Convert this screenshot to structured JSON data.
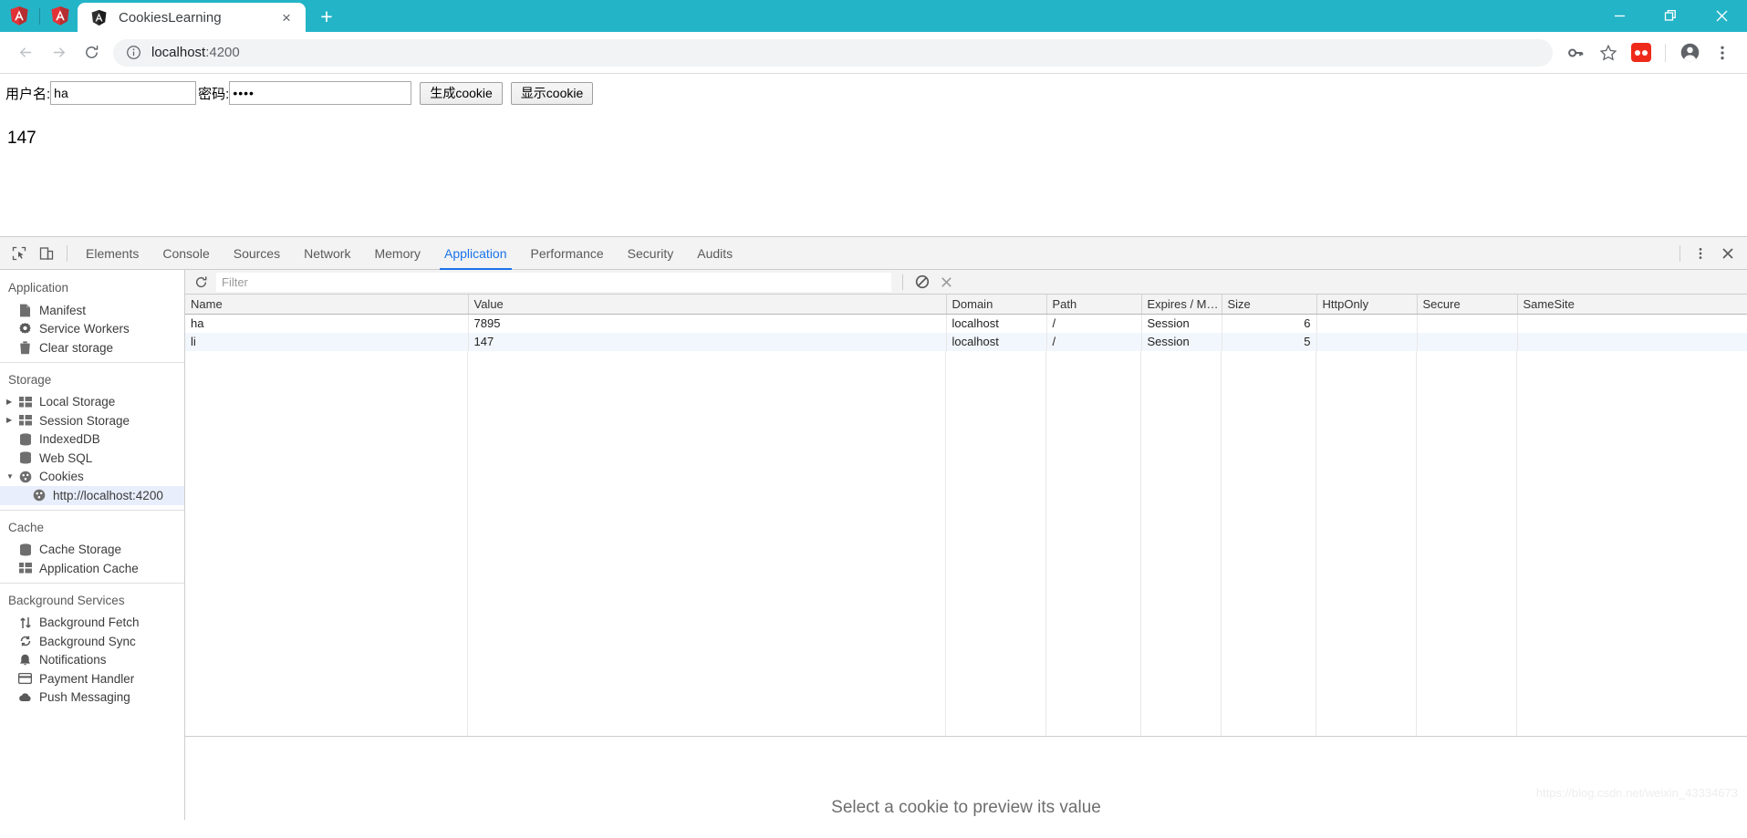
{
  "browser": {
    "pinned_tabs": [
      {
        "name": "angular-pinned-tab-1",
        "title": "Angular"
      },
      {
        "name": "angular-pinned-tab-2",
        "title": "Angular"
      }
    ],
    "active_tab": {
      "title": "CookiesLearning",
      "favicon": "angular-icon",
      "close_label": "×"
    },
    "new_tab_label": "+",
    "window_controls": {
      "minimize": "—",
      "restore": "restore-icon",
      "close": "×"
    },
    "nav": {
      "back": "back-arrow-icon",
      "forward": "forward-arrow-icon",
      "reload": "reload-icon"
    },
    "omnibox": {
      "info_icon": "info-circle-icon",
      "host": "localhost",
      "port": ":4200",
      "full_url": "localhost:4200"
    },
    "toolbar_icons": [
      {
        "name": "password-key-icon",
        "label": "Passwords"
      },
      {
        "name": "bookmark-star-icon",
        "label": "Bookmark"
      },
      {
        "name": "extension-icon",
        "label": "Extension"
      },
      {
        "name": "profile-avatar-icon",
        "label": "Profile"
      },
      {
        "name": "chrome-menu-icon",
        "label": "Customize and control"
      }
    ],
    "accent_color": "#24b4c7"
  },
  "page": {
    "username_label": "用户名:",
    "username_value": "ha",
    "username_placeholder": "",
    "password_label": "密码:",
    "password_value": "••••",
    "password_placeholder": "",
    "generate_button": "生成cookie",
    "show_button": "显示cookie",
    "result": "147"
  },
  "devtools": {
    "inspect_icon": "inspect-element-icon",
    "device_icon": "device-toolbar-icon",
    "tabs": [
      {
        "label": "Elements",
        "active": false
      },
      {
        "label": "Console",
        "active": false
      },
      {
        "label": "Sources",
        "active": false
      },
      {
        "label": "Network",
        "active": false
      },
      {
        "label": "Memory",
        "active": false
      },
      {
        "label": "Application",
        "active": true
      },
      {
        "label": "Performance",
        "active": false
      },
      {
        "label": "Security",
        "active": false
      },
      {
        "label": "Audits",
        "active": false
      }
    ],
    "active_tab_color": "#1a73e8",
    "more_icon": "devtools-more-options-icon",
    "close_icon": "devtools-close-icon",
    "sidebar": {
      "sections": [
        {
          "title": "Application",
          "items": [
            {
              "label": "Manifest",
              "icon": "document-icon",
              "arrow": "none",
              "selected": false,
              "nested": false
            },
            {
              "label": "Service Workers",
              "icon": "gear-icon",
              "arrow": "none",
              "selected": false,
              "nested": false
            },
            {
              "label": "Clear storage",
              "icon": "trash-icon",
              "arrow": "none",
              "selected": false,
              "nested": false
            }
          ]
        },
        {
          "title": "Storage",
          "items": [
            {
              "label": "Local Storage",
              "icon": "table-grid-icon",
              "arrow": "collapsed",
              "selected": false,
              "nested": false
            },
            {
              "label": "Session Storage",
              "icon": "table-grid-icon",
              "arrow": "collapsed",
              "selected": false,
              "nested": false
            },
            {
              "label": "IndexedDB",
              "icon": "database-icon",
              "arrow": "none",
              "selected": false,
              "nested": false
            },
            {
              "label": "Web SQL",
              "icon": "database-icon",
              "arrow": "none",
              "selected": false,
              "nested": false
            },
            {
              "label": "Cookies",
              "icon": "cookie-icon",
              "arrow": "expanded",
              "selected": false,
              "nested": false
            },
            {
              "label": "http://localhost:4200",
              "icon": "cookie-icon",
              "arrow": "none",
              "selected": true,
              "nested": true
            }
          ]
        },
        {
          "title": "Cache",
          "items": [
            {
              "label": "Cache Storage",
              "icon": "database-icon",
              "arrow": "none",
              "selected": false,
              "nested": false
            },
            {
              "label": "Application Cache",
              "icon": "table-grid-icon",
              "arrow": "none",
              "selected": false,
              "nested": false
            }
          ]
        },
        {
          "title": "Background Services",
          "items": [
            {
              "label": "Background Fetch",
              "icon": "updown-arrows-icon",
              "arrow": "none",
              "selected": false,
              "nested": false
            },
            {
              "label": "Background Sync",
              "icon": "sync-icon",
              "arrow": "none",
              "selected": false,
              "nested": false
            },
            {
              "label": "Notifications",
              "icon": "bell-icon",
              "arrow": "none",
              "selected": false,
              "nested": false
            },
            {
              "label": "Payment Handler",
              "icon": "credit-card-icon",
              "arrow": "none",
              "selected": false,
              "nested": false
            },
            {
              "label": "Push Messaging",
              "icon": "cloud-icon",
              "arrow": "none",
              "selected": false,
              "nested": false
            }
          ]
        }
      ]
    },
    "cookie_toolbar": {
      "refresh_icon": "refresh-icon",
      "filter_placeholder": "Filter",
      "filter_value": "",
      "clear_all_icon": "clear-all-cookies-icon",
      "delete_icon": "delete-selected-cookie-icon"
    },
    "cookie_table": {
      "columns": [
        "Name",
        "Value",
        "Domain",
        "Path",
        "Expires / Ma...",
        "Size",
        "HttpOnly",
        "Secure",
        "SameSite"
      ],
      "rows": [
        {
          "Name": "ha",
          "Value": "7895",
          "Domain": "localhost",
          "Path": "/",
          "Expires": "Session",
          "Size": "6",
          "HttpOnly": "",
          "Secure": "",
          "SameSite": ""
        },
        {
          "Name": "li",
          "Value": "147",
          "Domain": "localhost",
          "Path": "/",
          "Expires": "Session",
          "Size": "5",
          "HttpOnly": "",
          "Secure": "",
          "SameSite": ""
        }
      ]
    },
    "preview": {
      "message": "Select a cookie to preview its value"
    }
  },
  "watermark": "https://blog.csdn.net/weixin_43334673"
}
